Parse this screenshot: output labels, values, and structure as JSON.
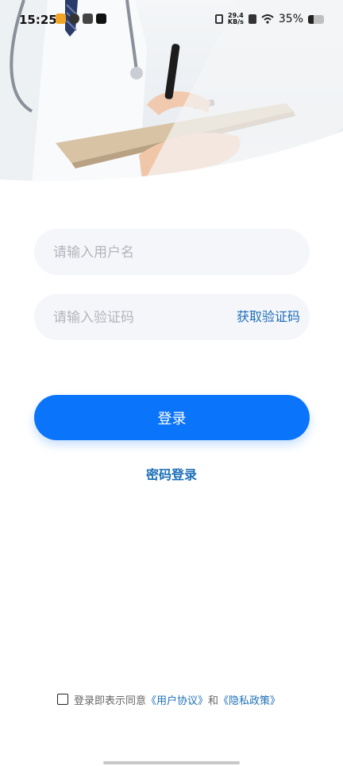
{
  "status_bar": {
    "time": "15:25",
    "net_speed_value": "29.4",
    "net_speed_unit": "KB/s",
    "battery_percent": "35%",
    "battery_level": 0.35
  },
  "form": {
    "username_placeholder": "请输入用户名",
    "code_placeholder": "请输入验证码",
    "get_code_label": "获取验证码"
  },
  "login_label": "登录",
  "password_login_label": "密码登录",
  "agreement": {
    "prefix": "登录即表示同意",
    "user_agreement": "《用户协议》",
    "conjunction": "和",
    "privacy_policy": "《隐私政策》"
  },
  "colors": {
    "primary": "#0a74fb",
    "link": "#1d6fb8",
    "field_bg": "#f5f6fa"
  }
}
